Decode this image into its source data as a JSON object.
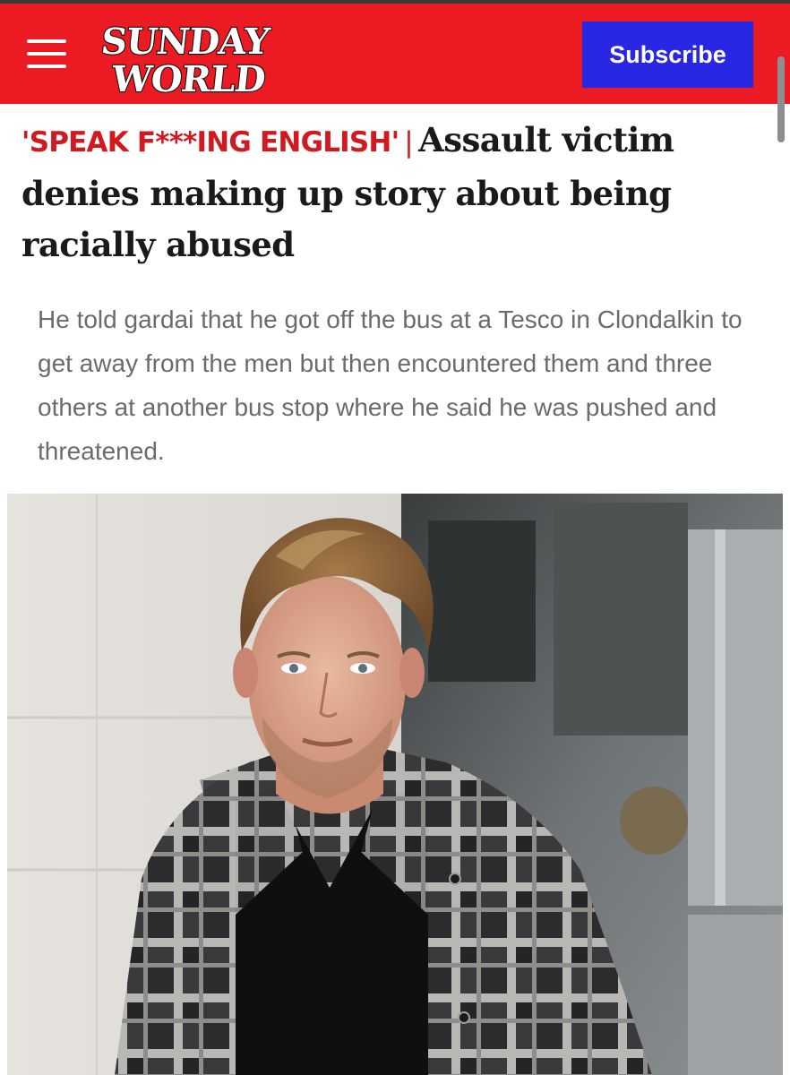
{
  "header": {
    "logo_line1": "SUNDAY",
    "logo_line2": "WORLD",
    "subscribe_label": "Subscribe",
    "background_color": "#ec1b23",
    "subscribe_color": "#2727e4"
  },
  "article": {
    "kicker": "'SPEAK F***ING ENGLISH'",
    "separator": "|",
    "headline": "Assault victim denies making up story about being racially abused",
    "standfirst": "He told gardai that he got off the bus at a Tesco in Clondalkin to get away from the men but then encountered them and three others at another bus stop where he said he was pushed and threatened."
  },
  "icons": {
    "menu": "hamburger-menu-icon"
  }
}
